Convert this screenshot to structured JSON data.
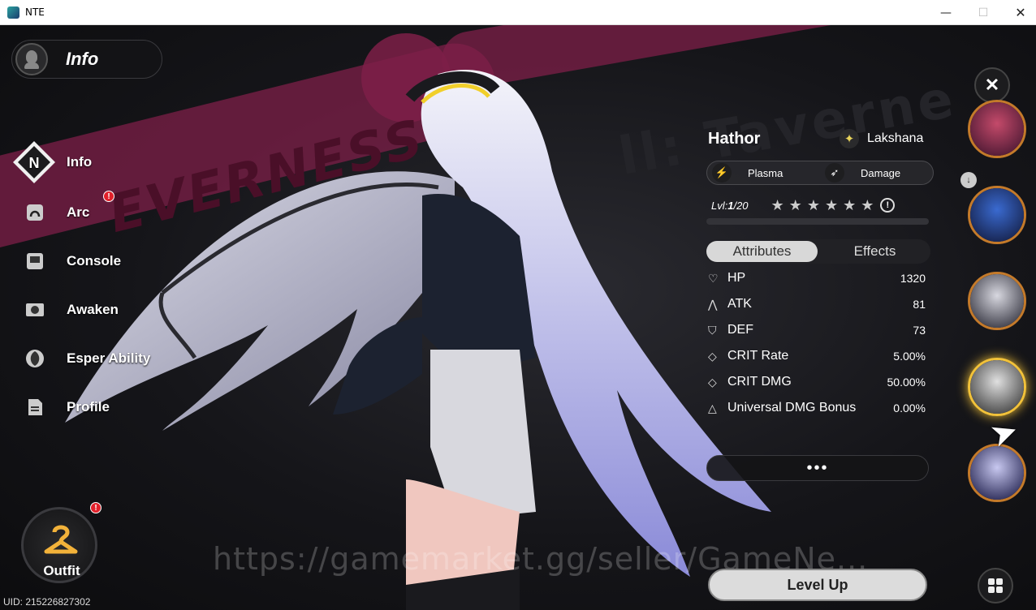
{
  "window": {
    "title": "NTE",
    "minimize": "—",
    "maximize": "☐",
    "close": "✕"
  },
  "header": {
    "label": "Info"
  },
  "nav": {
    "items": [
      {
        "label": "Info",
        "icon": "nte-logo-icon",
        "active": true
      },
      {
        "label": "Arc",
        "icon": "arc-icon",
        "badge": "!"
      },
      {
        "label": "Console",
        "icon": "console-icon"
      },
      {
        "label": "Awaken",
        "icon": "awaken-icon"
      },
      {
        "label": "Esper Ability",
        "icon": "esper-ability-icon"
      },
      {
        "label": "Profile",
        "icon": "profile-icon"
      }
    ]
  },
  "outfit": {
    "label": "Outfit",
    "badge": "!"
  },
  "uid": "UID: 215226827302",
  "watermark": "https://gamemarket.gg/seller/GameNe...",
  "background": {
    "banner_text": "EVERNESS",
    "banner_text_2": "ll: Taverne"
  },
  "character": {
    "name": "Hathor",
    "faction": "Lakshana",
    "tags": [
      {
        "label": "Plasma",
        "icon": "plasma-icon"
      },
      {
        "label": "Damage",
        "icon": "damage-icon"
      }
    ],
    "level_label": "Lvl:",
    "level_current": "1",
    "level_max": "/20",
    "level_progress": 0,
    "stars": "★★★★★★",
    "lock": "!"
  },
  "tabs": {
    "attributes": "Attributes",
    "effects": "Effects"
  },
  "attributes": [
    {
      "label": "HP",
      "value": "1320",
      "icon": "heart-icon"
    },
    {
      "label": "ATK",
      "value": "81",
      "icon": "atk-icon"
    },
    {
      "label": "DEF",
      "value": "73",
      "icon": "shield-icon"
    },
    {
      "label": "CRIT Rate",
      "value": "5.00%",
      "icon": "crit-rate-icon"
    },
    {
      "label": "CRIT DMG",
      "value": "50.00%",
      "icon": "crit-dmg-icon"
    },
    {
      "label": "Universal DMG Bonus",
      "value": "0.00%",
      "icon": "triangle-icon"
    }
  ],
  "more_label": "•••",
  "level_up_label": "Level Up",
  "close_label": "✕",
  "roster": [
    {
      "name": "portrait-1",
      "colors": [
        "#5a1f3a",
        "#c44a6a"
      ]
    },
    {
      "name": "portrait-2",
      "colors": [
        "#1a2a5a",
        "#3a6ad0"
      ]
    },
    {
      "name": "portrait-3",
      "colors": [
        "#4a4a55",
        "#d8d8e0"
      ]
    },
    {
      "name": "portrait-4",
      "colors": [
        "#555",
        "#e0e0e0"
      ],
      "active": true
    },
    {
      "name": "portrait-5",
      "colors": [
        "#3a3a66",
        "#c8c8f0"
      ]
    }
  ],
  "colors": {
    "accent": "#f2c23a",
    "banner": "#7d1f48",
    "badge": "#e0202a"
  }
}
